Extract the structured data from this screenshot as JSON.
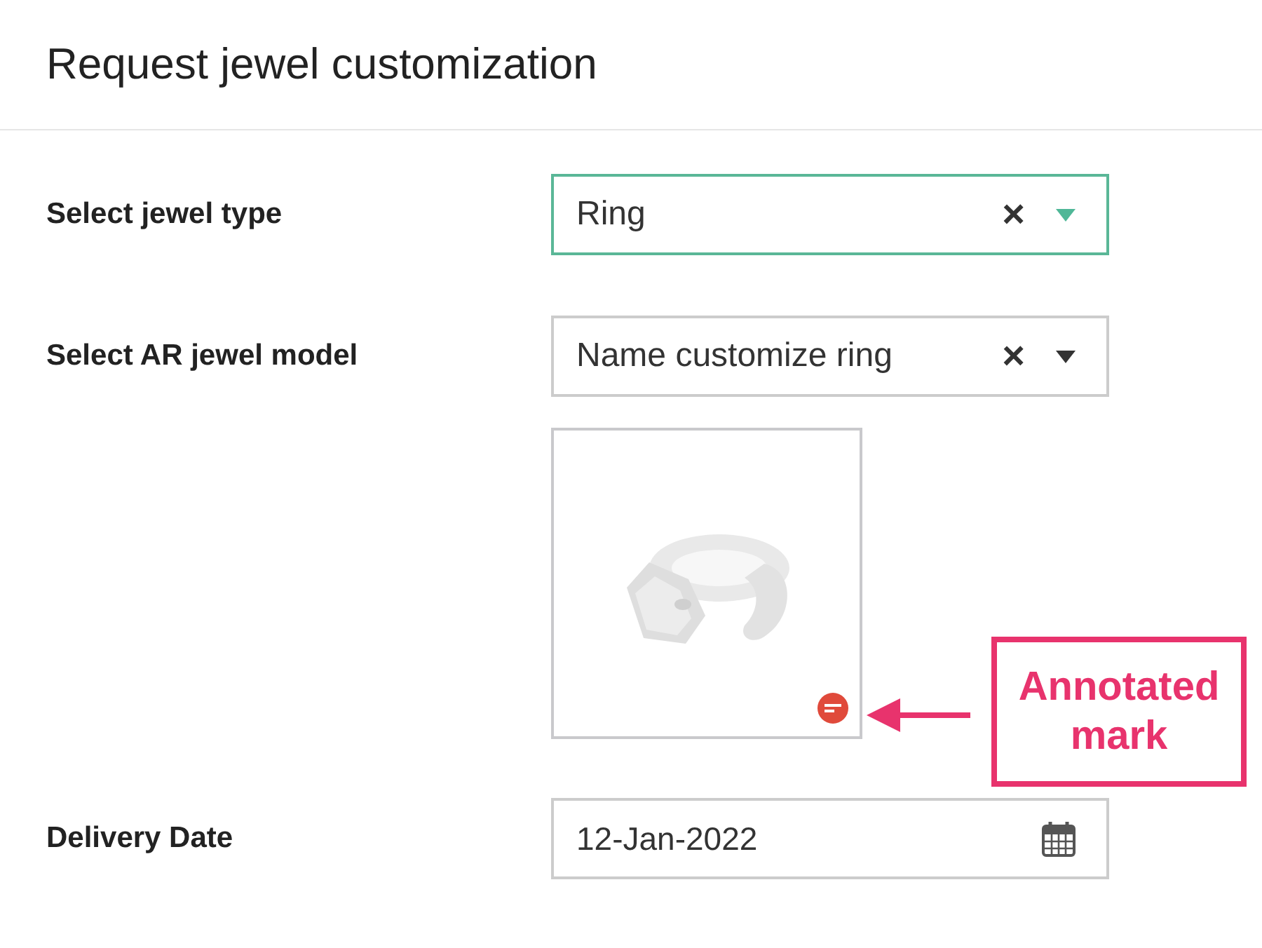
{
  "title": "Request jewel customization",
  "fields": [
    {
      "kind": "select",
      "label": "Select jewel type",
      "value": "Ring",
      "focused": true,
      "clear": "×"
    },
    {
      "kind": "select",
      "label": "Select AR jewel model",
      "value": "Name customize ring",
      "focused": false,
      "clear": "×"
    },
    {
      "remove_badge": true,
      "annotation": "Annotated mark"
    },
    {
      "kind": "date",
      "label": "Delivery Date",
      "value": "12-Jan-2022"
    }
  ]
}
